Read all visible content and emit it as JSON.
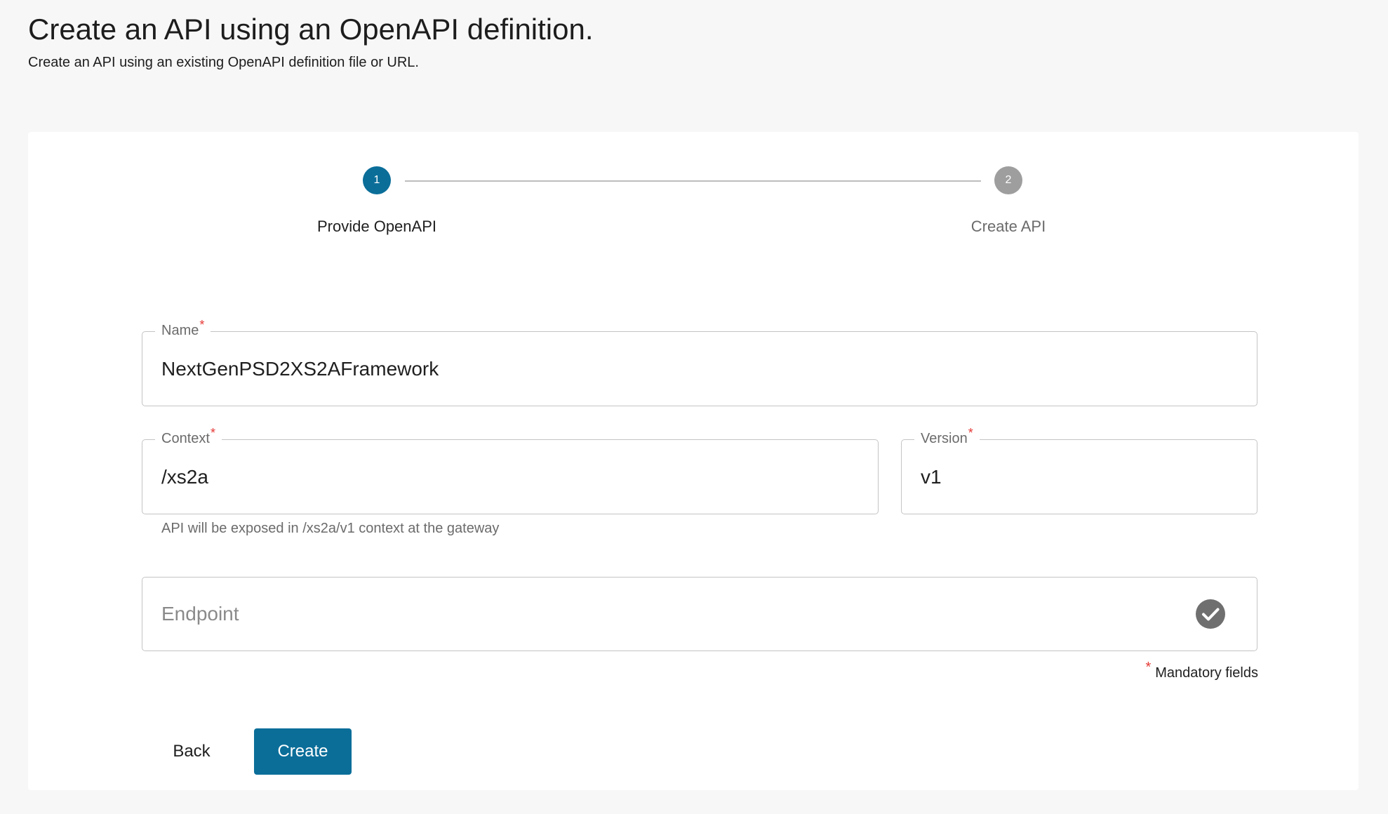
{
  "header": {
    "title": "Create an API using an OpenAPI definition.",
    "subtitle": "Create an API using an existing OpenAPI definition file or URL."
  },
  "stepper": {
    "steps": [
      {
        "number": "1",
        "label": "Provide OpenAPI",
        "state": "active"
      },
      {
        "number": "2",
        "label": "Create API",
        "state": "inactive"
      }
    ]
  },
  "form": {
    "name": {
      "label": "Name",
      "required_mark": "*",
      "value": "NextGenPSD2XS2AFramework"
    },
    "context": {
      "label": "Context",
      "required_mark": "*",
      "value": "/xs2a"
    },
    "version": {
      "label": "Version",
      "required_mark": "*",
      "value": "v1"
    },
    "context_helper": "API will be exposed in /xs2a/v1 context at the gateway",
    "endpoint": {
      "placeholder": "Endpoint",
      "value": "",
      "status_icon": "check-circle-icon"
    },
    "mandatory_note": {
      "mark": "*",
      "text": "Mandatory fields"
    }
  },
  "actions": {
    "back_label": "Back",
    "create_label": "Create"
  },
  "colors": {
    "primary": "#0b6e99",
    "inactive_step": "#9e9e9e",
    "required": "#e53935",
    "background": "#f7f7f7"
  }
}
